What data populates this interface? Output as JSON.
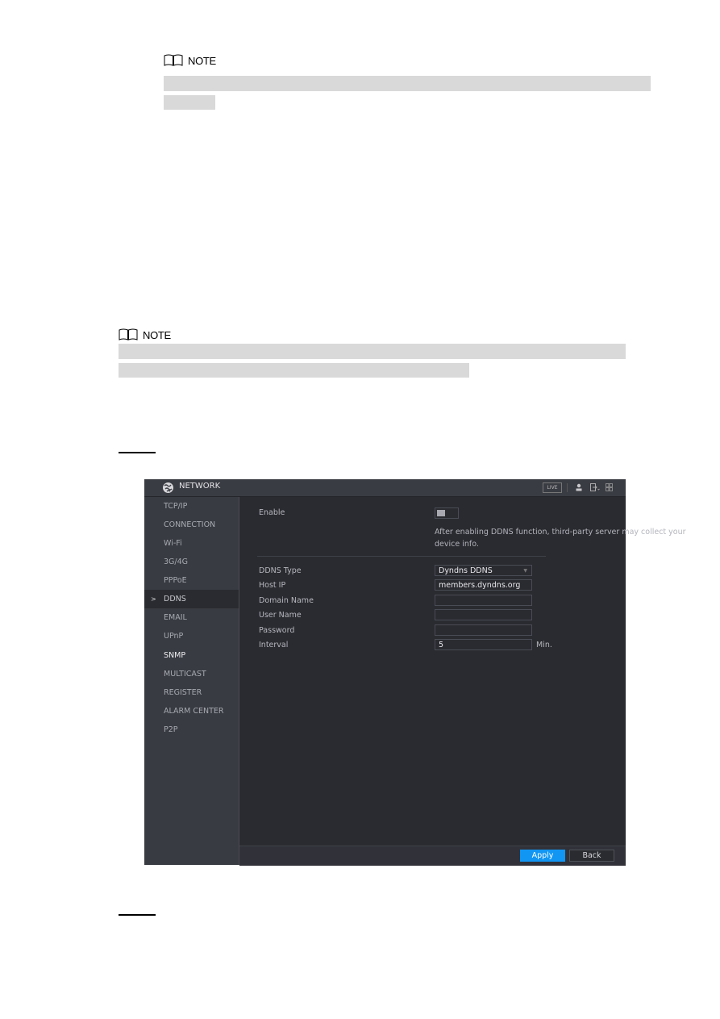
{
  "notes": [
    {
      "label": "NOTE"
    },
    {
      "label": "NOTE"
    }
  ],
  "app": {
    "title": "NETWORK",
    "topbar": {
      "live_label": "LIVE",
      "icons": [
        "user-icon",
        "logout-icon",
        "grid-icon"
      ]
    },
    "sidebar": {
      "items": [
        {
          "label": "TCP/IP"
        },
        {
          "label": "CONNECTION"
        },
        {
          "label": "Wi-Fi"
        },
        {
          "label": "3G/4G"
        },
        {
          "label": "PPPoE"
        },
        {
          "label": "DDNS",
          "active": true
        },
        {
          "label": "EMAIL"
        },
        {
          "label": "UPnP"
        },
        {
          "label": "SNMP"
        },
        {
          "label": "MULTICAST"
        },
        {
          "label": "REGISTER"
        },
        {
          "label": "ALARM CENTER"
        },
        {
          "label": "P2P"
        }
      ],
      "active_marker": ">"
    },
    "form": {
      "enable_label": "Enable",
      "enable_on": false,
      "hint": "After enabling DDNS function, third-party server may collect your device info.",
      "ddns_type_label": "DDNS Type",
      "ddns_type_value": "Dyndns DDNS",
      "host_ip_label": "Host IP",
      "host_ip_value": "members.dyndns.org",
      "domain_name_label": "Domain Name",
      "domain_name_value": "",
      "user_name_label": "User Name",
      "user_name_value": "",
      "password_label": "Password",
      "password_value": "",
      "interval_label": "Interval",
      "interval_value": "5",
      "interval_unit": "Min."
    },
    "footer": {
      "apply_label": "Apply",
      "back_label": "Back"
    },
    "colors": {
      "accent": "#1196f4",
      "background": "#2a2b30",
      "sidebar": "#393b42"
    }
  }
}
